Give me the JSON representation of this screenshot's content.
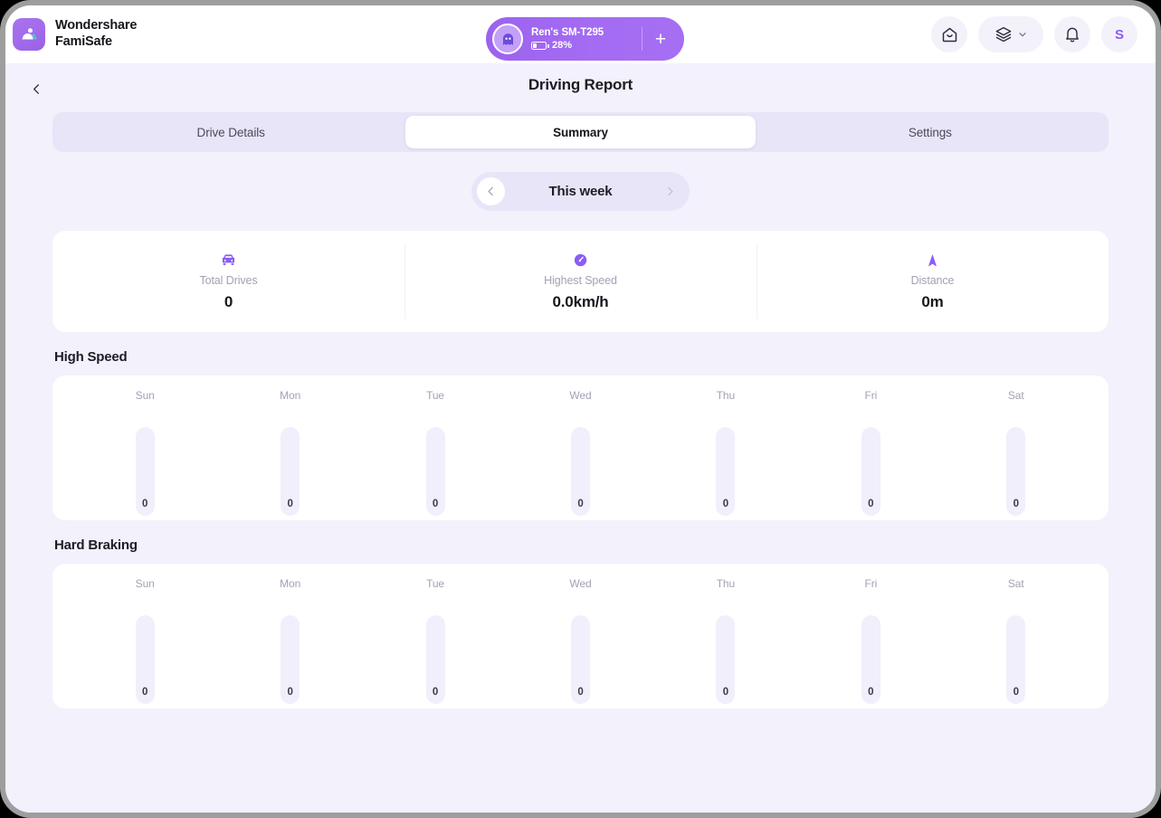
{
  "brand": {
    "name_line1": "Wondershare",
    "name_line2": "FamiSafe",
    "logo_icon": "famisafe-logo-icon"
  },
  "device_pill": {
    "avatar_icon": "ghost-avatar-icon",
    "device_name": "Ren's SM-T295",
    "battery_icon": "battery-icon",
    "battery_percent": "28%",
    "battery_level": 28,
    "add_label": "+"
  },
  "header_actions": {
    "home_icon": "home-icon",
    "layers_icon": "layers-icon",
    "chevron_icon": "chevron-down-icon",
    "bell_icon": "bell-icon",
    "avatar_initial": "S"
  },
  "page": {
    "back_icon": "chevron-left-icon",
    "title": "Driving Report"
  },
  "tabs": [
    {
      "label": "Drive Details",
      "active": false
    },
    {
      "label": "Summary",
      "active": true
    },
    {
      "label": "Settings",
      "active": false
    }
  ],
  "week_switcher": {
    "prev_icon": "chevron-left-icon",
    "next_icon": "chevron-right-icon",
    "label": "This week"
  },
  "stats": [
    {
      "icon": "car-icon",
      "label": "Total Drives",
      "value": "0"
    },
    {
      "icon": "speedometer-icon",
      "label": "Highest Speed",
      "value": "0.0km/h"
    },
    {
      "icon": "navigation-arrow-icon",
      "label": "Distance",
      "value": "0m"
    }
  ],
  "sections": [
    {
      "heading": "High Speed"
    },
    {
      "heading": "Hard Braking"
    }
  ],
  "colors": {
    "accent": "#8b5cf6",
    "page_bg": "#f2f1fc",
    "card_bg": "#ffffff",
    "track_bg": "#f1effb",
    "muted_text": "#a3a1b4"
  },
  "chart_data": [
    {
      "type": "bar",
      "title": "High Speed",
      "categories": [
        "Sun",
        "Mon",
        "Tue",
        "Wed",
        "Thu",
        "Fri",
        "Sat"
      ],
      "values": [
        0,
        0,
        0,
        0,
        0,
        0,
        0
      ],
      "data_labels": [
        "0",
        "0",
        "0",
        "0",
        "0",
        "0",
        "0"
      ],
      "xlabel": "",
      "ylabel": "",
      "ylim": [
        0,
        1
      ],
      "grid": false,
      "legend": false
    },
    {
      "type": "bar",
      "title": "Hard Braking",
      "categories": [
        "Sun",
        "Mon",
        "Tue",
        "Wed",
        "Thu",
        "Fri",
        "Sat"
      ],
      "values": [
        0,
        0,
        0,
        0,
        0,
        0,
        0
      ],
      "data_labels": [
        "0",
        "0",
        "0",
        "0",
        "0",
        "0",
        "0"
      ],
      "xlabel": "",
      "ylabel": "",
      "ylim": [
        0,
        1
      ],
      "grid": false,
      "legend": false
    }
  ]
}
